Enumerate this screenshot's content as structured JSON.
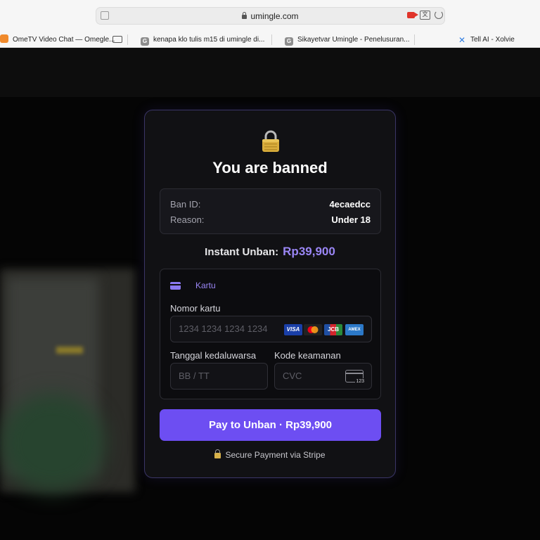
{
  "browser": {
    "url": "umingle.com",
    "tabs": [
      {
        "label": "OmeTV Video Chat — Omegle..."
      },
      {
        "label": "kenapa klo tulis m15 di umingle di..."
      },
      {
        "label": "Sikayetvar Umingle - Penelusuran..."
      },
      {
        "label": "Tell AI - Xolvie"
      }
    ]
  },
  "modal": {
    "title": "You are banned",
    "ban_info": {
      "ban_id_label": "Ban ID:",
      "ban_id_value": "4ecaedcc",
      "reason_label": "Reason:",
      "reason_value": "Under 18"
    },
    "price": {
      "label": "Instant Unban:",
      "amount": "Rp39,900"
    },
    "card_form": {
      "tab_label": "Kartu",
      "card_number_label": "Nomor kartu",
      "card_number_placeholder": "1234 1234 1234 1234",
      "expiry_label": "Tanggal kedaluwarsa",
      "expiry_placeholder": "BB / TT",
      "cvc_label": "Kode keamanan",
      "cvc_placeholder": "CVC",
      "brands": [
        "VISA",
        "mastercard",
        "JCB",
        "AMEX"
      ],
      "cvc_icon_text": "123"
    },
    "pay_button": "Pay to Unban · Rp39,900",
    "secure_text": "Secure Payment via Stripe"
  },
  "colors": {
    "accent": "#6d4ef2",
    "price": "#9a86f5",
    "modal_bg": "#111114"
  }
}
